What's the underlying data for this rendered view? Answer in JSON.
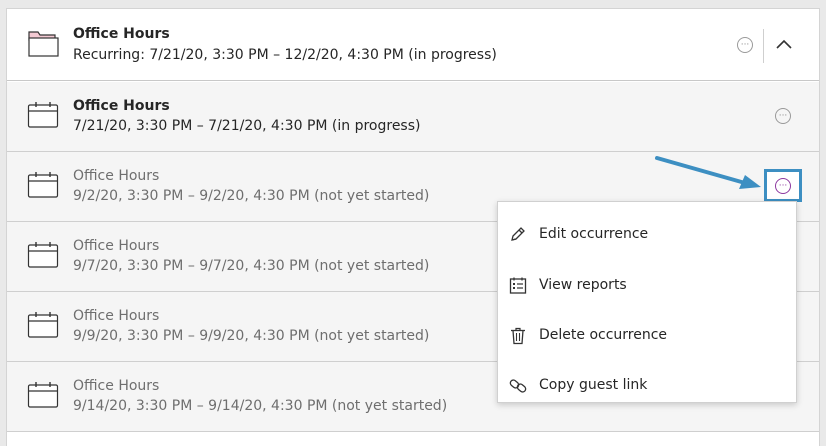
{
  "series": {
    "title": "Office Hours",
    "subtitle": "Recurring: 7/21/20, 3:30 PM – 12/2/20, 4:30 PM (in progress)",
    "icon": "folder-icon"
  },
  "occurrences": [
    {
      "title": "Office Hours",
      "subtitle": "7/21/20, 3:30 PM – 7/21/20, 4:30 PM (in progress)"
    },
    {
      "title": "Office Hours",
      "subtitle": "9/2/20, 3:30 PM – 9/2/20, 4:30 PM (not yet started)"
    },
    {
      "title": "Office Hours",
      "subtitle": "9/7/20, 3:30 PM – 9/7/20, 4:30 PM (not yet started)"
    },
    {
      "title": "Office Hours",
      "subtitle": "9/9/20, 3:30 PM – 9/9/20, 4:30 PM (not yet started)"
    },
    {
      "title": "Office Hours",
      "subtitle": "9/14/20, 3:30 PM – 9/14/20, 4:30 PM (not yet started)"
    }
  ],
  "more_glyph": "···",
  "menu": {
    "items": [
      {
        "label": "Edit occurrence",
        "icon": "pencil-icon"
      },
      {
        "label": "View reports",
        "icon": "report-icon"
      },
      {
        "label": "Delete occurrence",
        "icon": "trash-icon"
      },
      {
        "label": "Copy guest link",
        "icon": "link-icon"
      }
    ]
  },
  "colors": {
    "highlight": "#3d8fc2",
    "menu_button_active": "#8e3aa0",
    "folder_tab": "#f3c9d2"
  }
}
